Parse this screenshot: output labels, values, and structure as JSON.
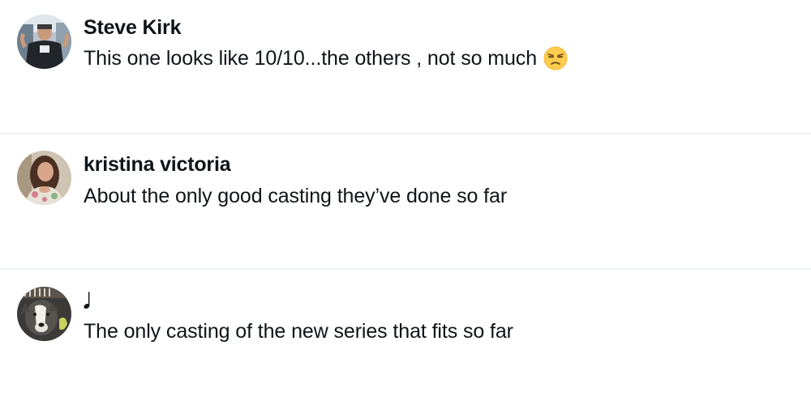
{
  "replies": [
    {
      "author": "Steve Kirk",
      "text": "This one looks like 10/10...the others , not so much",
      "emoji": "unamused-face-icon",
      "avatar": "avatar-steve-kirk"
    },
    {
      "author": "kristina victoria",
      "text": "About the only good casting they’ve done so far",
      "avatar": "avatar-kristina-victoria"
    },
    {
      "author": "𝅘𝅥",
      "text": "The only casting of the new series that fits so far",
      "avatar": "avatar-dog"
    }
  ],
  "colors": {
    "text": "#0f1419",
    "divider": "#eff3f4",
    "emoji_face": "#ffcc4d"
  }
}
